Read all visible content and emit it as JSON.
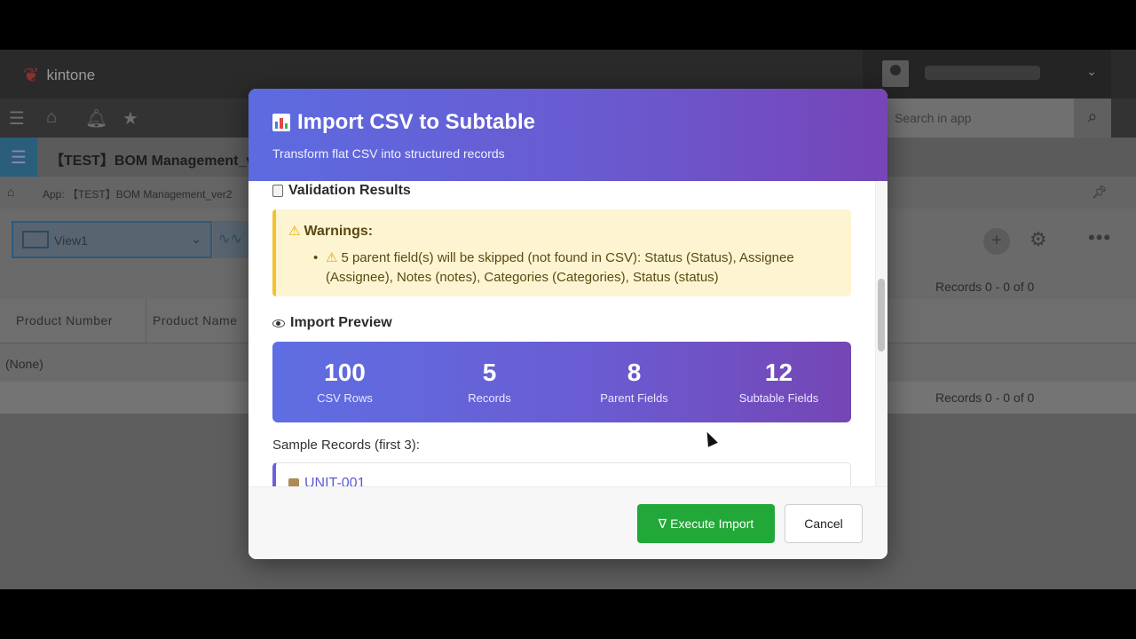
{
  "app": {
    "brand": "kintone",
    "search_placeholder": "Search in app",
    "app_title": "【TEST】BOM Management_v",
    "breadcrumb": "App: 【TEST】BOM Management_ver2",
    "view_name": "View1",
    "records_summary_top": "Records 0 - 0 of 0",
    "records_summary_bottom": "Records 0 - 0 of 0",
    "table_headers": [
      "Product Number",
      "Product Name"
    ],
    "empty_row": "(None)"
  },
  "modal": {
    "title": "Import CSV to Subtable",
    "subtitle": "Transform flat CSV into structured records",
    "validation_title": "Validation Results",
    "warnings_title": "Warnings:",
    "warnings": [
      "5 parent field(s) will be skipped (not found in CSV): Status (Status), Assignee (Assignee), Notes (notes), Categories (Categories), Status (status)"
    ],
    "preview_title": "Import Preview",
    "stats": [
      {
        "value": "100",
        "label": "CSV Rows"
      },
      {
        "value": "5",
        "label": "Records"
      },
      {
        "value": "8",
        "label": "Parent Fields"
      },
      {
        "value": "12",
        "label": "Subtable Fields"
      }
    ],
    "sample_title": "Sample Records (first 3):",
    "sample_records": [
      "UNIT-001"
    ],
    "execute_label": "Execute Import",
    "cancel_label": "Cancel"
  },
  "colors": {
    "header_gradient_start": "#5d6be0",
    "header_gradient_end": "#7645b8",
    "execute_green": "#22a838",
    "warning_bg": "#fdf5d2",
    "warning_border": "#f2c230"
  },
  "icons": {
    "title": "bar-chart-icon",
    "validation": "clipboard-icon",
    "warning": "warning-icon",
    "preview": "eye-icon",
    "sample": "package-icon",
    "execute": "check-icon"
  }
}
